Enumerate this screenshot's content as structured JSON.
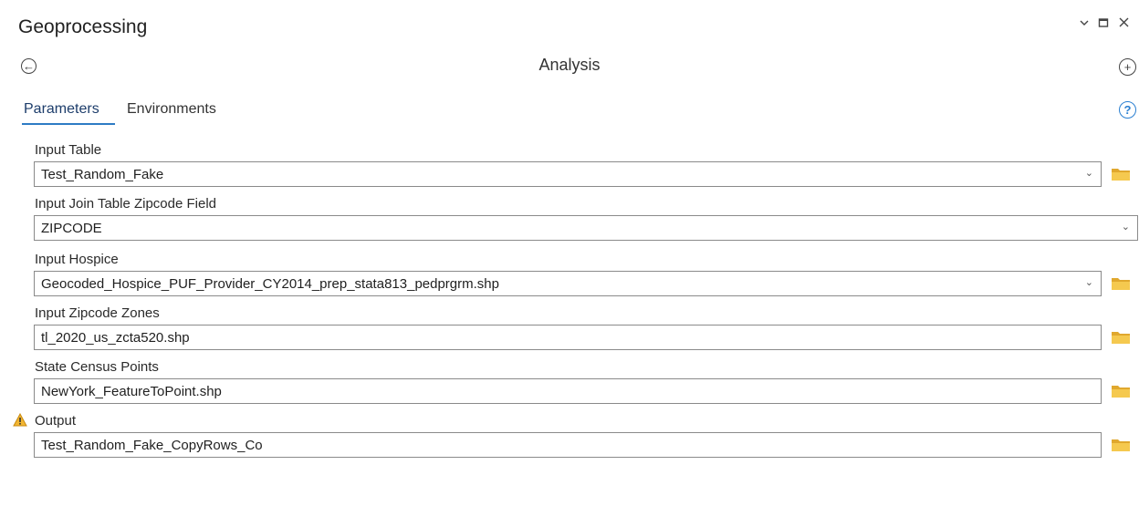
{
  "window": {
    "title": "Geoprocessing"
  },
  "tool": {
    "name": "Analysis"
  },
  "tabs": [
    {
      "label": "Parameters",
      "active": true
    },
    {
      "label": "Environments",
      "active": false
    }
  ],
  "params": {
    "input_table": {
      "label": "Input Table",
      "value": "Test_Random_Fake"
    },
    "join_field": {
      "label": "Input Join Table Zipcode Field",
      "value": "ZIPCODE"
    },
    "input_hospice": {
      "label": "Input Hospice",
      "value": "Geocoded_Hospice_PUF_Provider_CY2014_prep_stata813_pedprgrm.shp"
    },
    "zipcode_zones": {
      "label": "Input Zipcode Zones",
      "value": "tl_2020_us_zcta520.shp"
    },
    "census_points": {
      "label": "State Census Points",
      "value": "NewYork_FeatureToPoint.shp"
    },
    "output": {
      "label": "Output",
      "value": "Test_Random_Fake_CopyRows_Co",
      "warning": true
    }
  },
  "colors": {
    "accent": "#2d7bc4",
    "folder": "#f0c24b",
    "warning": "#e8a317"
  },
  "icons": {
    "back": "back-arrow-circle-icon",
    "add": "plus-circle-icon",
    "help": "question-circle-icon",
    "browse": "folder-icon",
    "warning": "warning-triangle-icon"
  }
}
